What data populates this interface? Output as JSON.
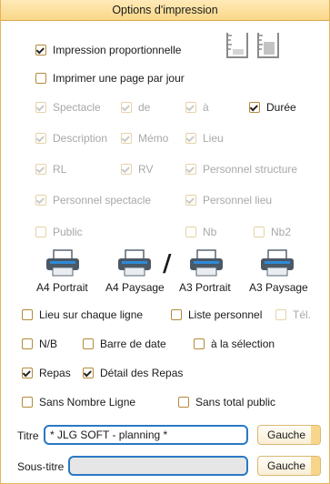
{
  "window": {
    "title": "Options d'impression"
  },
  "options": {
    "proportionnelle": {
      "label": "Impression proportionnelle",
      "checked": true
    },
    "page_par_jour": {
      "label": "Imprimer une page par jour",
      "checked": false
    }
  },
  "columns": {
    "spectacle": {
      "label": "Spectacle",
      "checked": true,
      "enabled": false
    },
    "de": {
      "label": "de",
      "checked": true,
      "enabled": false
    },
    "a": {
      "label": "à",
      "checked": true,
      "enabled": false
    },
    "duree": {
      "label": "Durée",
      "checked": true,
      "enabled": true
    },
    "description": {
      "label": "Description",
      "checked": true,
      "enabled": false
    },
    "memo": {
      "label": "Mémo",
      "checked": true,
      "enabled": false
    },
    "lieu": {
      "label": "Lieu",
      "checked": true,
      "enabled": false
    },
    "rl": {
      "label": "RL",
      "checked": true,
      "enabled": false
    },
    "rv": {
      "label": "RV",
      "checked": true,
      "enabled": false
    },
    "personnel_structure": {
      "label": "Personnel structure",
      "checked": true,
      "enabled": false
    },
    "personnel_spectacle": {
      "label": "Personnel spectacle",
      "checked": true,
      "enabled": false
    },
    "personnel_lieu": {
      "label": "Personnel lieu",
      "checked": true,
      "enabled": false
    },
    "public": {
      "label": "Public",
      "checked": false,
      "enabled": false
    },
    "nb": {
      "label": "Nb",
      "checked": false,
      "enabled": false
    },
    "nb2": {
      "label": "Nb2",
      "checked": false,
      "enabled": false
    }
  },
  "print_buttons": {
    "a4_portrait": "A4 Portrait",
    "a4_paysage": "A4 Paysage",
    "separator": "/",
    "a3_portrait": "A3 Portrait",
    "a3_paysage": "A3 Paysage"
  },
  "lower_options": {
    "lieu_chaque_ligne": {
      "label": "Lieu sur chaque ligne",
      "checked": false
    },
    "liste_personnel": {
      "label": "Liste personnel",
      "checked": false
    },
    "tel": {
      "label": "Tél.",
      "checked": false,
      "enabled": false
    },
    "nb_bw": {
      "label": "N/B",
      "checked": false
    },
    "barre_date": {
      "label": "Barre de date",
      "checked": false
    },
    "a_la_selection": {
      "label": "à la sélection",
      "checked": false
    },
    "repas": {
      "label": "Repas",
      "checked": true
    },
    "detail_repas": {
      "label": "Détail des Repas",
      "checked": true
    },
    "sans_nombre_ligne": {
      "label": "Sans Nombre Ligne",
      "checked": false
    },
    "sans_total_public": {
      "label": "Sans total public",
      "checked": false
    }
  },
  "titre": {
    "label": "Titre",
    "value": "* JLG SOFT - planning *",
    "align_button": "Gauche"
  },
  "sous_titre": {
    "label": "Sous-titre",
    "value": "",
    "align_button": "Gauche"
  },
  "colors": {
    "accent": "#2a78c4",
    "checkbox_border": "#b58a3a",
    "titlebar": "#f9d888"
  },
  "icons": [
    "glass-empty-icon",
    "glass-half-icon",
    "printer-icon"
  ]
}
